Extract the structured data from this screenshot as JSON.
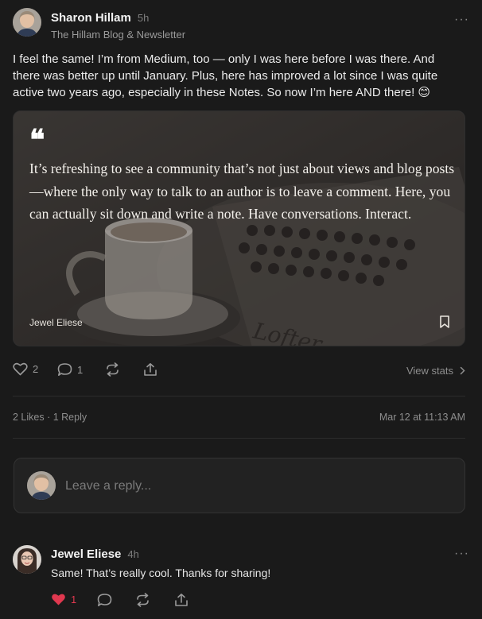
{
  "post": {
    "author": "Sharon Hillam",
    "time": "5h",
    "publication": "The Hillam Blog & Newsletter",
    "more_label": "···",
    "body": "I feel the same! I’m from Medium, too — only I was here before I was there. And there was better up until January. Plus, here has improved a lot since I was quite active two years ago, especially in these Notes. So now I’m here AND there! 😊",
    "quote": {
      "marks": "❝",
      "text": "It’s refreshing to see a community that’s not just about views and blog posts—where the only way to talk to an author is to leave a comment. Here, you can actually sit down and write a note. Have conversations. Interact.",
      "author": "Jewel Eliese"
    },
    "actions": {
      "likes": "2",
      "comments": "1",
      "view_stats": "View stats"
    },
    "meta": {
      "likes_replies": "2 Likes · 1 Reply",
      "date": "Mar 12 at 11:13 AM"
    }
  },
  "reply": {
    "placeholder": "Leave a reply..."
  },
  "comment": {
    "author": "Jewel Eliese",
    "time": "4h",
    "more_label": "···",
    "text": "Same! That’s really cool. Thanks for sharing!",
    "likes": "1"
  },
  "colors": {
    "background": "#1a1a1a",
    "liked_heart": "#e0384f"
  }
}
